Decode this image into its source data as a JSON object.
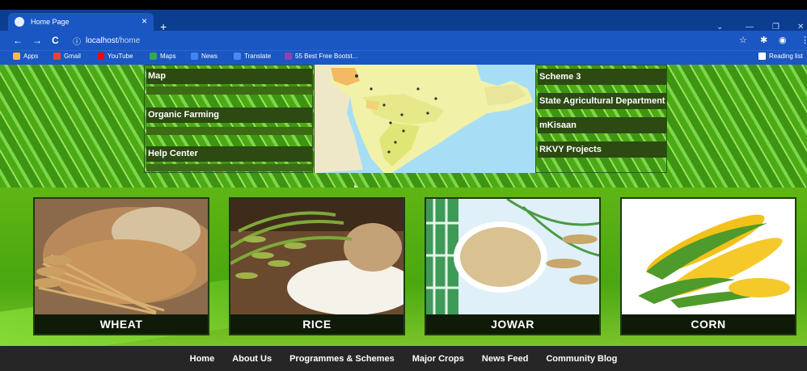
{
  "browser": {
    "tab_title": "Home Page",
    "tab_close": "×",
    "new_tab": "+",
    "url_info_icon": "ⓘ",
    "url_host": "localhost",
    "url_path": "/home",
    "window_controls": [
      "⌄",
      "—",
      "❐",
      "✕"
    ],
    "nav": {
      "back": "←",
      "forward": "→",
      "reload": "C"
    },
    "right_icons": [
      "☆",
      "✱",
      "◉",
      "⋮"
    ]
  },
  "bookmarks": [
    {
      "label": "Apps",
      "color": "#f2c230"
    },
    {
      "label": "Gmail",
      "color": "#ea4335"
    },
    {
      "label": "YouTube",
      "color": "#ff0000"
    },
    {
      "label": "Maps",
      "color": "#34a853"
    },
    {
      "label": "News",
      "color": "#4285f4"
    },
    {
      "label": "Translate",
      "color": "#4a8af4"
    },
    {
      "label": "55 Best Free Bootst...",
      "color": "#8e44ad"
    }
  ],
  "reading_list": "Reading list",
  "left_menu": [
    "Map",
    "Organic Farming",
    "Help Center"
  ],
  "right_menu": [
    "Scheme 3",
    "State Agricultural Department",
    "mKisaan",
    "RKVY Projects"
  ],
  "crops": [
    {
      "label": "WHEAT"
    },
    {
      "label": "RICE"
    },
    {
      "label": "JOWAR"
    },
    {
      "label": "CORN"
    }
  ],
  "footer_links": [
    "Home",
    "About Us",
    "Programmes & Schemes",
    "Major Crops",
    "News Feed",
    "Community Blog"
  ]
}
